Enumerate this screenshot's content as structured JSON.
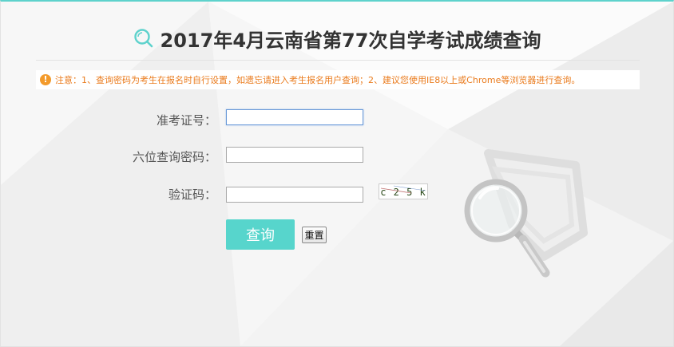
{
  "page": {
    "title": "2017年4月云南省第77次自学考试成绩查询",
    "notice": "注意：1、查询密码为考生在报名时自行设置，如遗忘请进入考生报名用户查询；2、建议您使用IE8以上或Chrome等浏览器进行查询。",
    "notice_icon": "!"
  },
  "form": {
    "exam_id_label": "准考证号：",
    "exam_id_value": "",
    "password_label": "六位查询密码：",
    "password_value": "",
    "captcha_label": "验证码：",
    "captcha_value": "",
    "captcha_text": "c 2 5 k"
  },
  "buttons": {
    "query": "查询",
    "reset": "重置"
  },
  "colors": {
    "accent": "#57d5cc",
    "warning": "#f39a2b",
    "notice_text": "#ea7a1b"
  },
  "icons": {
    "title_icon": "search-icon",
    "notice_icon": "warning-icon",
    "decoration": "magnifier-illustration"
  }
}
